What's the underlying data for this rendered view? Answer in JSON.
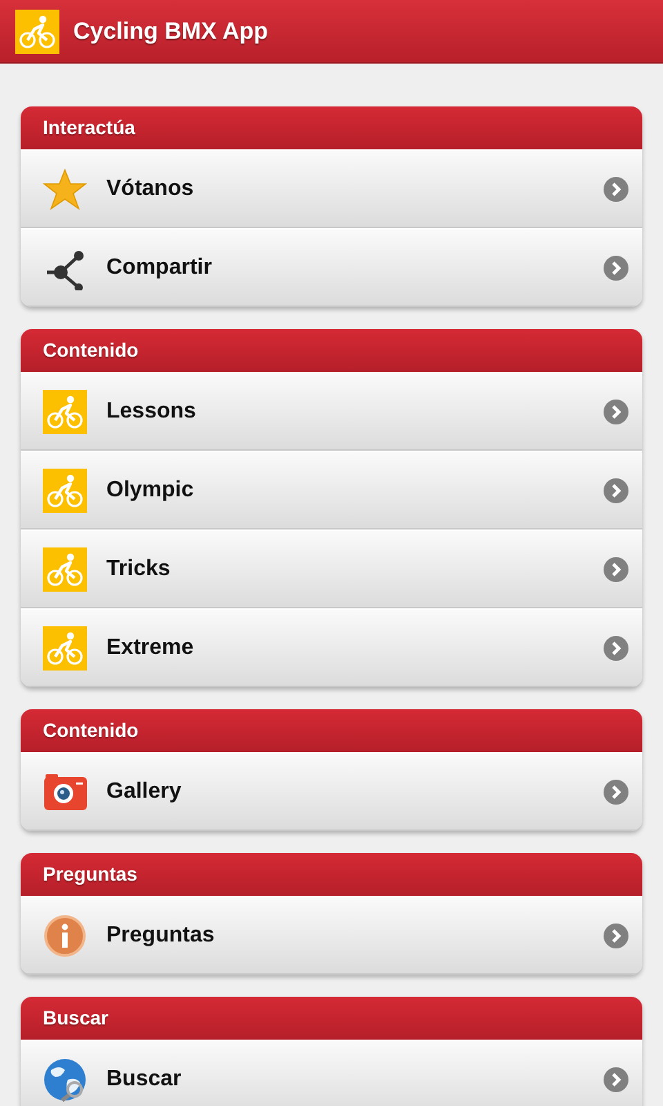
{
  "app_bar": {
    "title": "Cycling BMX App"
  },
  "sections": [
    {
      "title": "Interactúa",
      "items": [
        {
          "label": "Vótanos",
          "kind": "star"
        },
        {
          "label": "Compartir",
          "kind": "share"
        }
      ]
    },
    {
      "title": "Contenido",
      "items": [
        {
          "label": "Lessons",
          "kind": "cyclist"
        },
        {
          "label": "Olympic",
          "kind": "cyclist"
        },
        {
          "label": "Tricks",
          "kind": "cyclist"
        },
        {
          "label": "Extreme",
          "kind": "cyclist"
        }
      ]
    },
    {
      "title": "Contenido",
      "items": [
        {
          "label": "Gallery",
          "kind": "camera"
        }
      ]
    },
    {
      "title": "Preguntas",
      "items": [
        {
          "label": "Preguntas",
          "kind": "info"
        }
      ]
    },
    {
      "title": "Buscar",
      "items": [
        {
          "label": "Buscar",
          "kind": "globe"
        }
      ]
    }
  ]
}
